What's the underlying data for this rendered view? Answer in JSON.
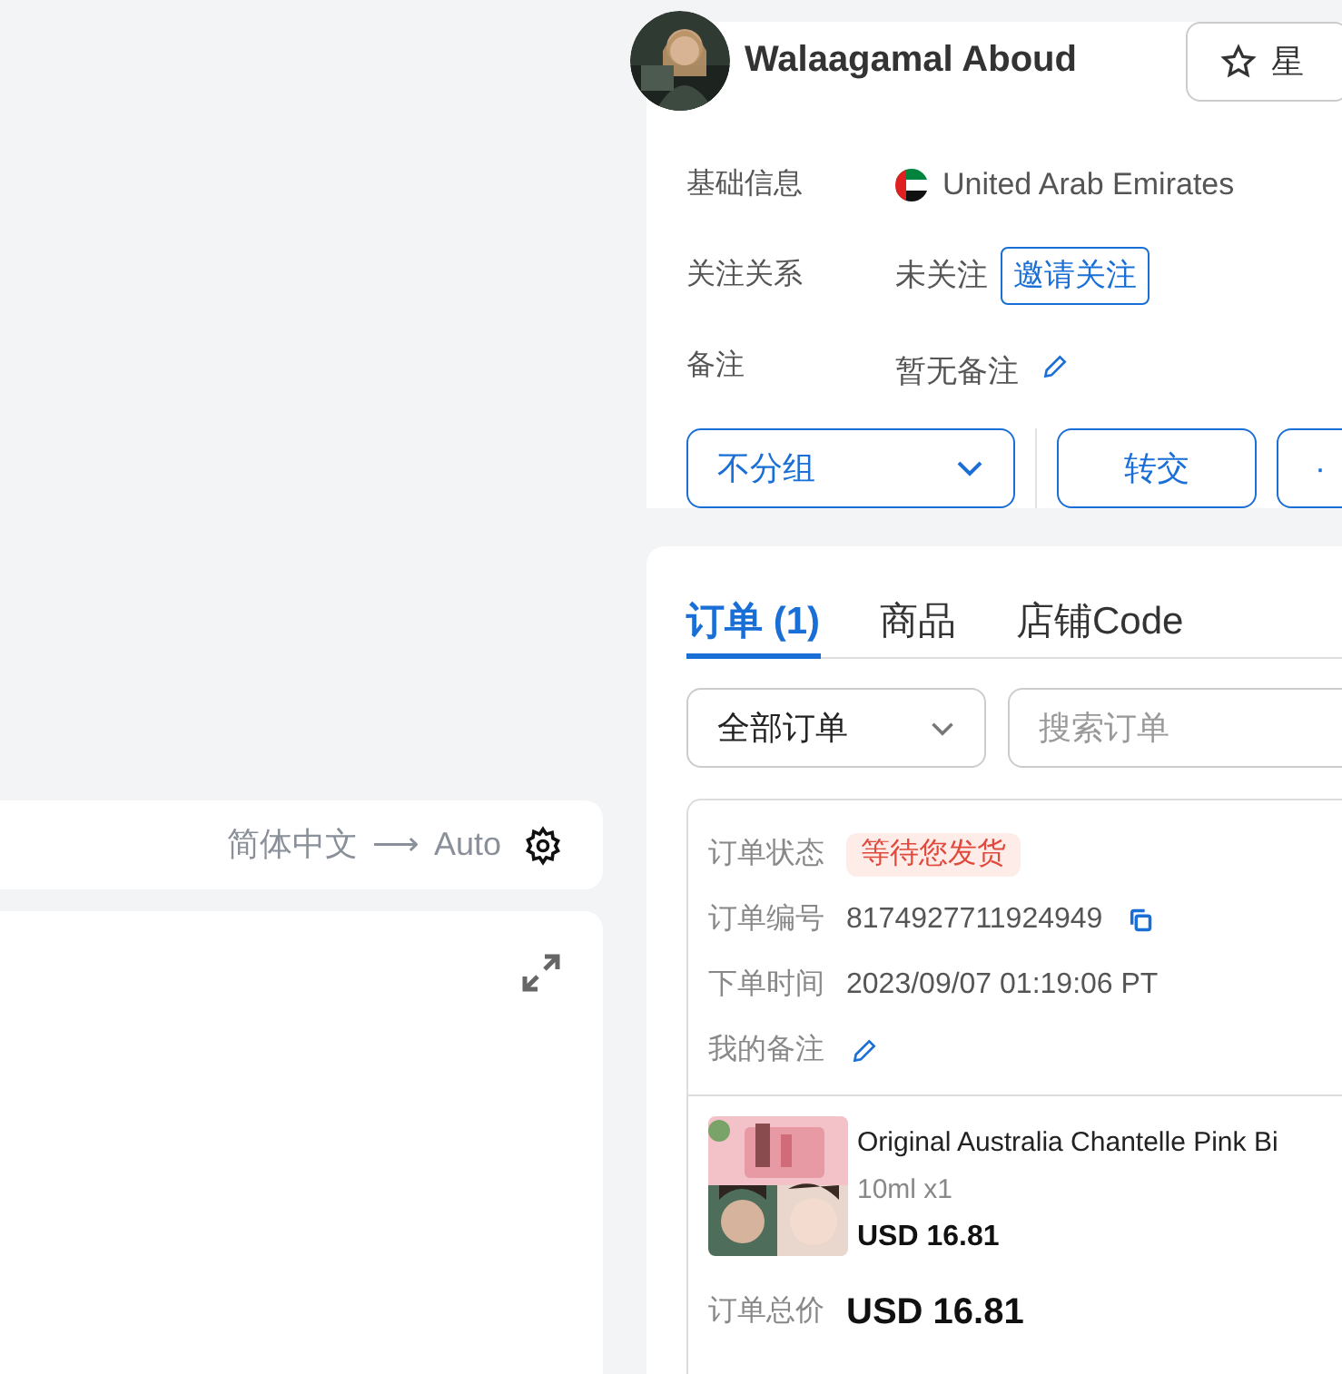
{
  "profile": {
    "name": "Walaagamal Aboud",
    "star_button": "星",
    "fields": [
      {
        "kind": "country",
        "label": "基础信息",
        "value": "United Arab Emirates"
      },
      {
        "kind": "follow",
        "label": "关注关系",
        "value": "未关注",
        "action": "邀请关注"
      },
      {
        "kind": "note",
        "label": "备注",
        "value": "暂无备注"
      }
    ],
    "group_select": "不分组",
    "transfer_button": "转交",
    "more_button": "·"
  },
  "chat": {
    "language_from": "简体中文",
    "arrow": "⟶",
    "language_to": "Auto"
  },
  "tabs": [
    {
      "label": "订单 (1)",
      "selected": true
    },
    {
      "label": "商品",
      "selected": false
    },
    {
      "label": "店铺Code",
      "selected": false
    }
  ],
  "order_filter": "全部订单",
  "order_search": {
    "placeholder": "搜索订单"
  },
  "order": {
    "fields": [
      {
        "kind": "status",
        "label": "订单状态",
        "value": "等待您发货"
      },
      {
        "kind": "copy",
        "label": "订单编号",
        "value": "8174927711924949"
      },
      {
        "kind": "text",
        "label": "下单时间",
        "value": "2023/09/07 01:19:06 PT"
      },
      {
        "kind": "edit",
        "label": "我的备注"
      }
    ],
    "item": {
      "title": "Original Australia Chantelle Pink Bi",
      "variant": "10ml x1",
      "price": "USD 16.81"
    },
    "total_label": "订单总价",
    "total": "USD 16.81"
  }
}
